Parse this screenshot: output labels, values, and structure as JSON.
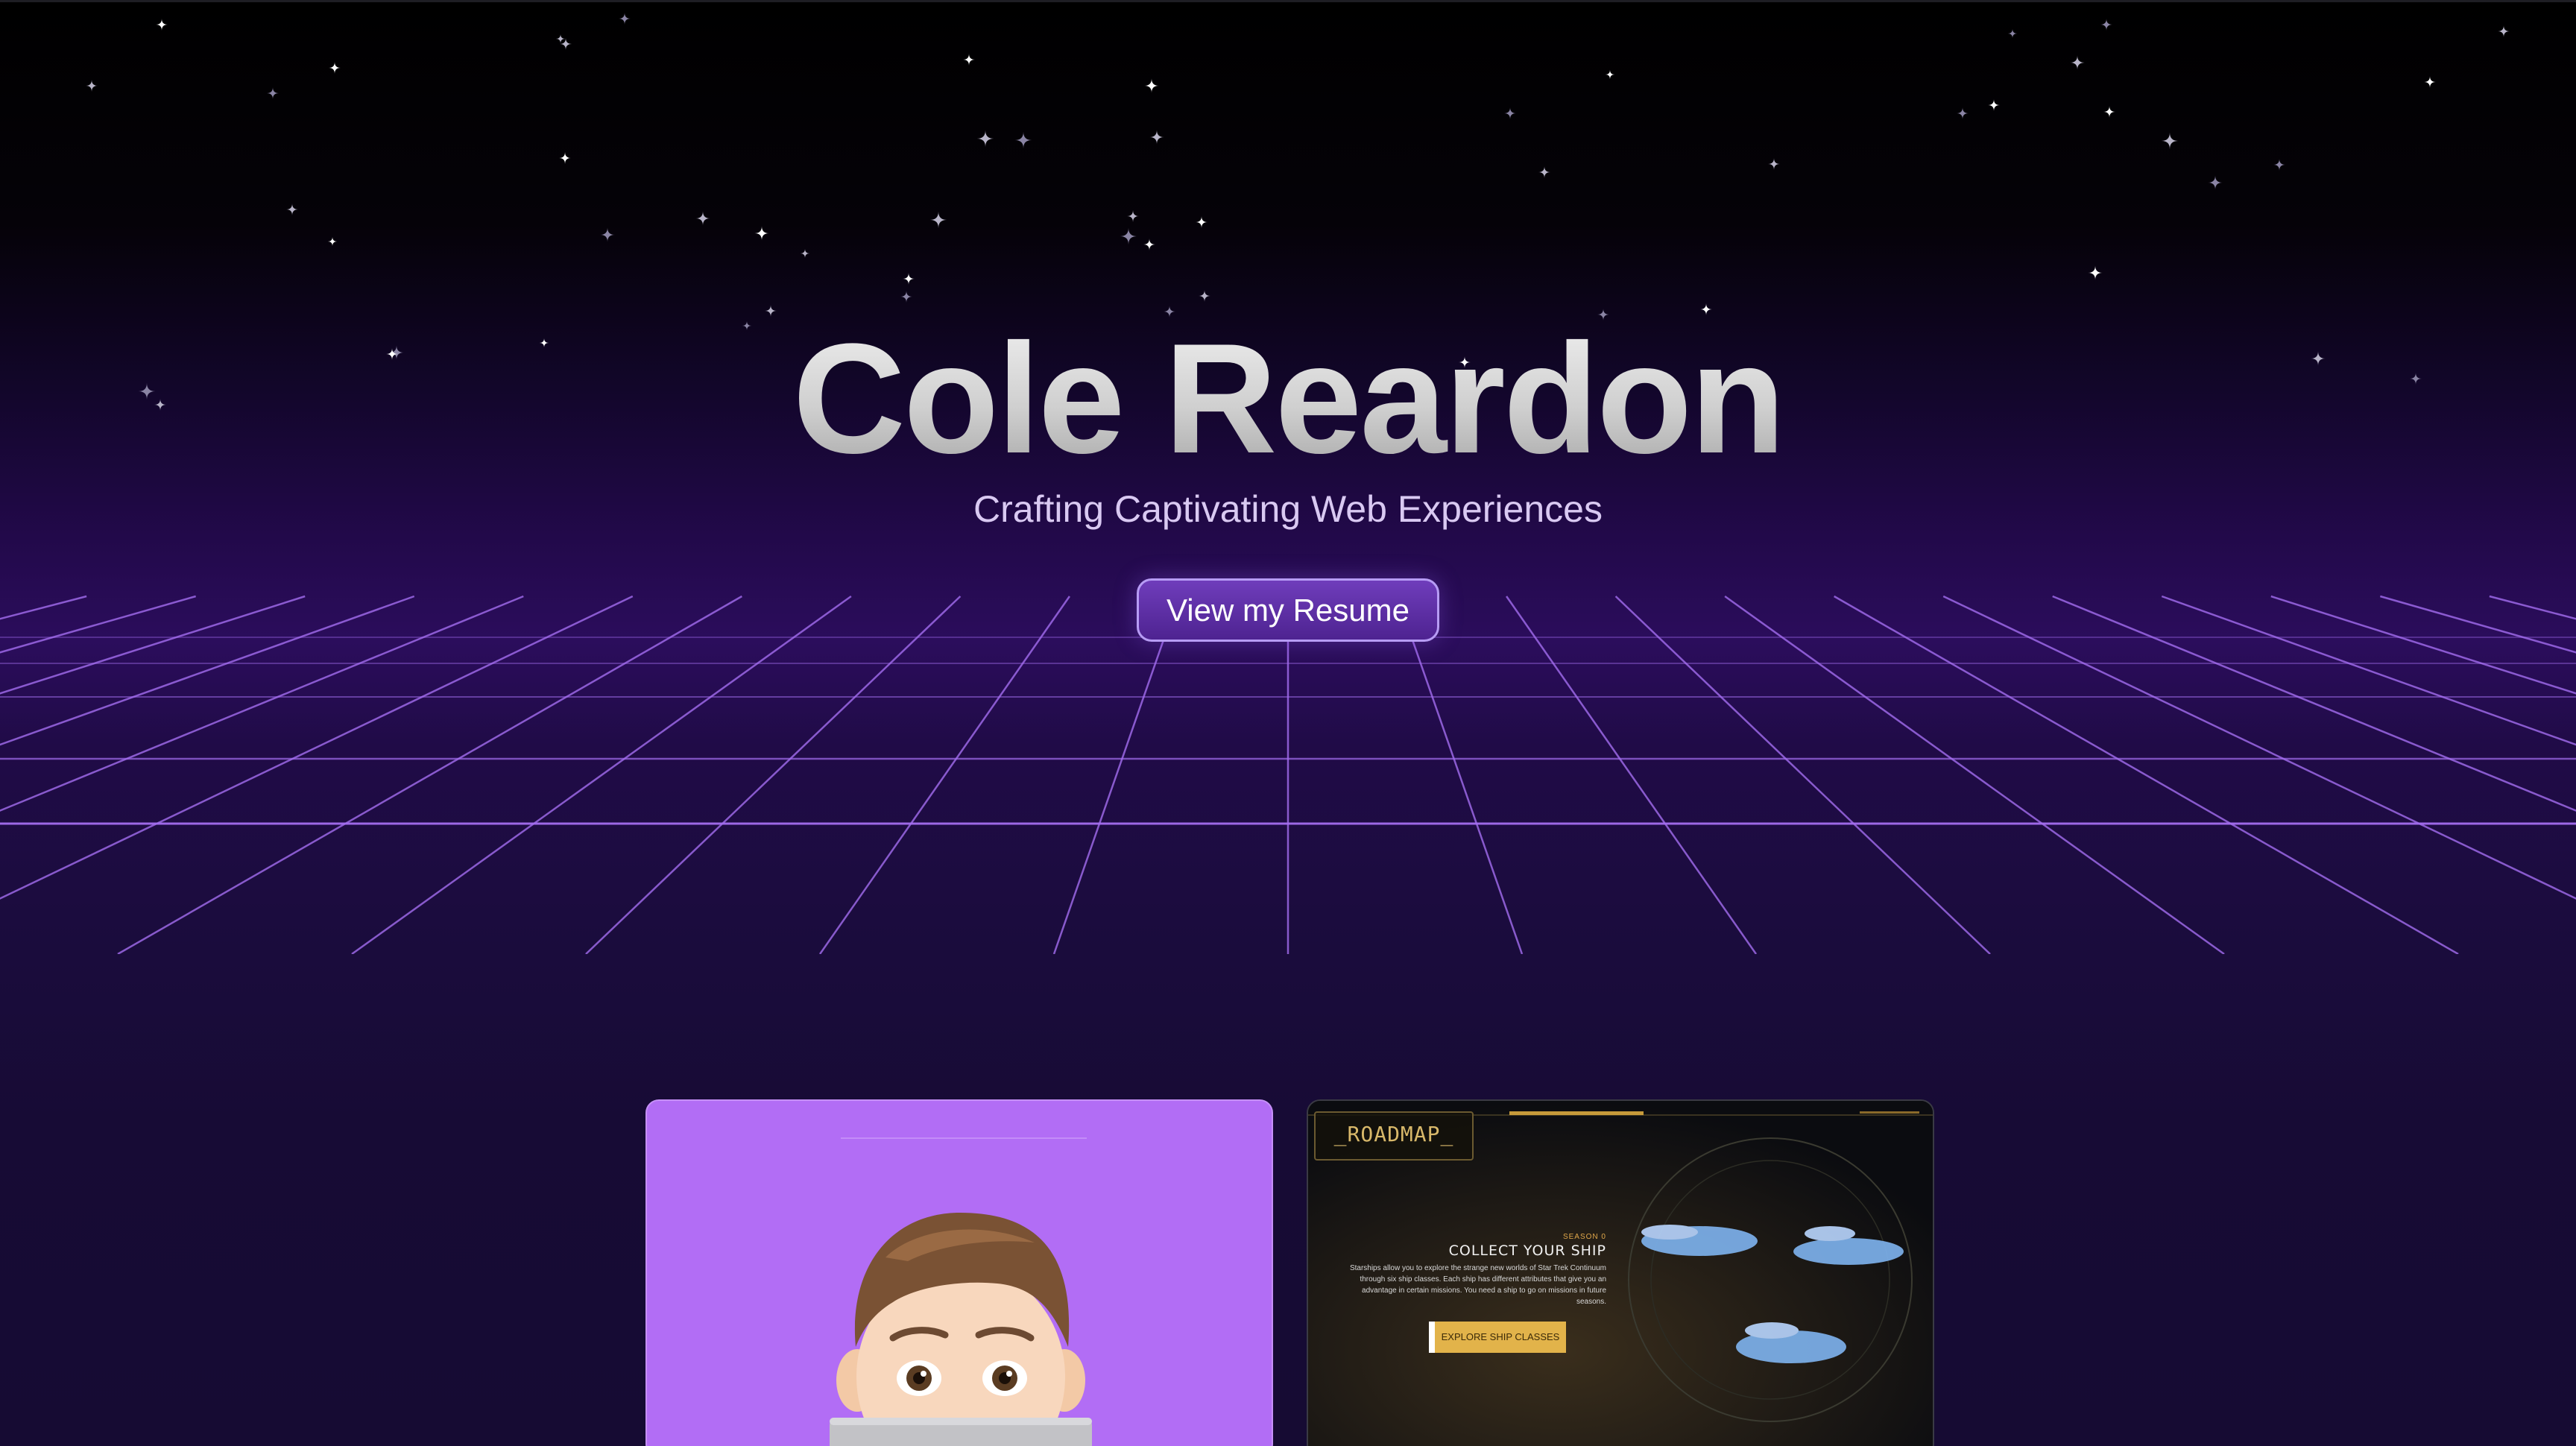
{
  "hero": {
    "title": "Cole Reardon",
    "subtitle": "Crafting Captivating Web Experiences",
    "resume_button_label": "View my Resume"
  },
  "projects": [
    {
      "type": "avatar-card",
      "background": "#b26df5"
    },
    {
      "type": "roadmap-card",
      "tab_label": "_ROADMAP_",
      "season_label": "SEASON 0",
      "heading": "COLLECT YOUR SHIP",
      "body": "Starships allow you to explore the strange new worlds of Star Trek Continuum through six ship classes. Each ship has different attributes that give you an advantage in certain missions. You need a ship to go on missions in future seasons.",
      "cta_label": "EXPLORE SHIP CLASSES"
    }
  ],
  "colors": {
    "accent": "#b26df5",
    "grid_line": "#a46ef0",
    "button_border": "#b79cf5",
    "roadmap_cta": "#e2b34a"
  }
}
